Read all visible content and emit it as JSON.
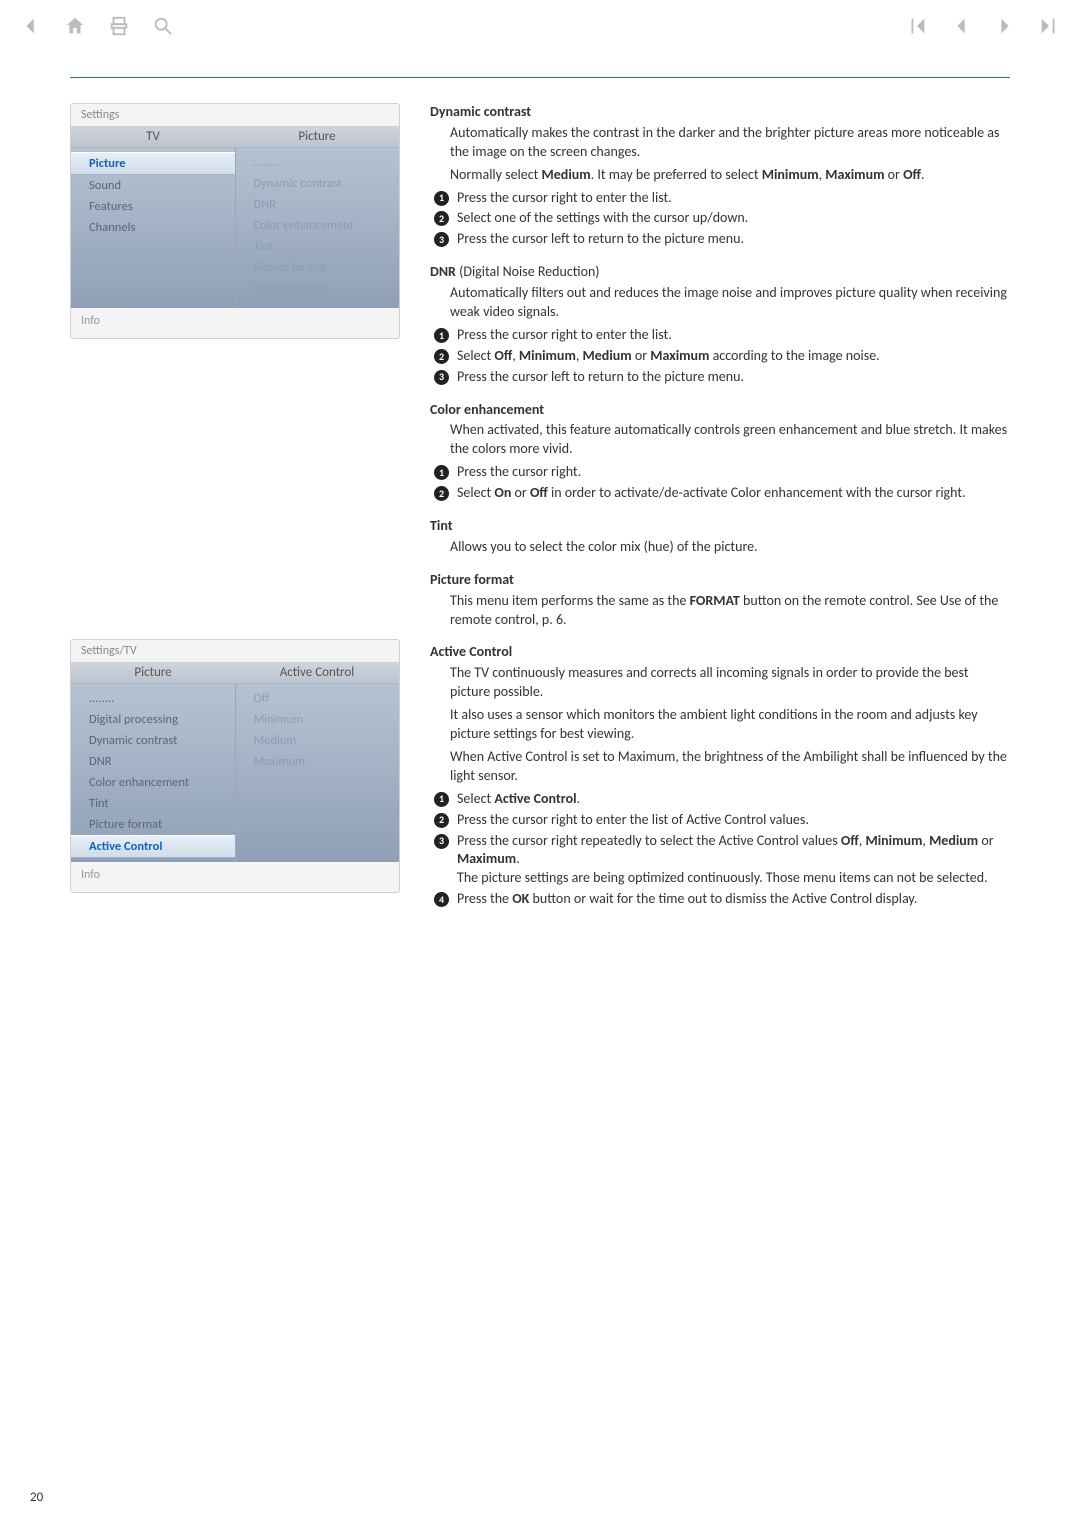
{
  "pageNumber": "20",
  "panel1": {
    "header": "Settings",
    "leftHead": "TV",
    "rightHead": "Picture",
    "leftItems": [
      "Picture",
      "Sound",
      "Features",
      "Channels"
    ],
    "rightItems": [
      "........",
      "Dynamic contrast",
      "DNR",
      "Color enhancement",
      "Tint",
      "Picture format",
      "Active Control"
    ],
    "footer": "Info"
  },
  "panel2": {
    "header": "Settings/TV",
    "leftHead": "Picture",
    "rightHead": "Active Control",
    "leftItems": [
      "........",
      "Digital processing",
      "Dynamic contrast",
      "DNR",
      "Color enhancement",
      "Tint",
      "Picture format",
      "Active Control"
    ],
    "rightItems": [
      "Off",
      "Minimum",
      "Medium",
      "Maximum"
    ],
    "footer": "Info"
  },
  "sections": {
    "dc": {
      "title": "Dynamic contrast",
      "desc1": "Automatically makes the contrast in the darker and the brighter picture areas more noticeable as the image on the screen changes.",
      "desc2a": "Normally select ",
      "desc2b": "Medium",
      "desc2c": ". It may be preferred to select ",
      "desc2d": "Minimum",
      "desc2e": ", ",
      "desc2f": "Maximum",
      "desc2g": " or ",
      "desc2h": "Off",
      "desc2i": ".",
      "s1": "Press the cursor right to enter the list.",
      "s2": "Select one of the settings with the cursor up/down.",
      "s3": "Press the cursor left to return to the picture menu."
    },
    "dnr": {
      "titleA": "DNR",
      "titleB": " (Digital Noise Reduction)",
      "desc": "Automatically filters out and reduces the image noise and improves picture quality when receiving weak video signals.",
      "s1": "Press the cursor right to enter the list.",
      "s2a": "Select ",
      "s2b": "Off",
      "s2c": ", ",
      "s2d": "Minimum",
      "s2e": ", ",
      "s2f": "Medium",
      "s2g": " or ",
      "s2h": "Maximum",
      "s2i": " according to the image noise.",
      "s3": "Press the cursor left to return to the picture menu."
    },
    "ce": {
      "title": "Color enhancement",
      "desc": "When activated, this feature automatically controls green enhancement and blue stretch. It makes the colors more vivid.",
      "s1": "Press the cursor right.",
      "s2a": "Select ",
      "s2b": "On",
      "s2c": " or ",
      "s2d": "Off",
      "s2e": " in order to activate/de-activate Color enhancement with the cursor right."
    },
    "tint": {
      "title": "Tint",
      "desc": "Allows you to select the color mix (hue) of the picture."
    },
    "pf": {
      "title": "Picture format",
      "d1": "This menu item performs the same as the ",
      "d2": "FORMAT",
      "d3": " button on the remote control. See Use of the remote control, p. 6."
    },
    "ac": {
      "title": "Active Control",
      "d1": "The TV continuously measures and corrects all incoming signals in order to provide the best picture possible.",
      "d2": "It also uses a sensor which monitors the ambient light conditions in the room and adjusts key picture settings for best viewing.",
      "d3": "When Active Control is set to Maximum, the brightness of the Ambilight shall be influenced by the light sensor.",
      "s1a": "Select ",
      "s1b": "Active Control",
      "s1c": ".",
      "s2": "Press the cursor right to enter the list of Active Control values.",
      "s3a": "Press the cursor right repeatedly to select the Active Control values ",
      "s3b": "Off",
      "s3c": ", ",
      "s3d": "Minimum",
      "s3e": ", ",
      "s3f": "Medium",
      "s3g": " or ",
      "s3h": "Maximum",
      "s3i": ".",
      "s3note": "The picture settings are being optimized continuously. Those menu items can not be selected.",
      "s4a": "Press the ",
      "s4b": "OK",
      "s4c": " button or wait for the time out to dismiss the Active Control display."
    }
  }
}
